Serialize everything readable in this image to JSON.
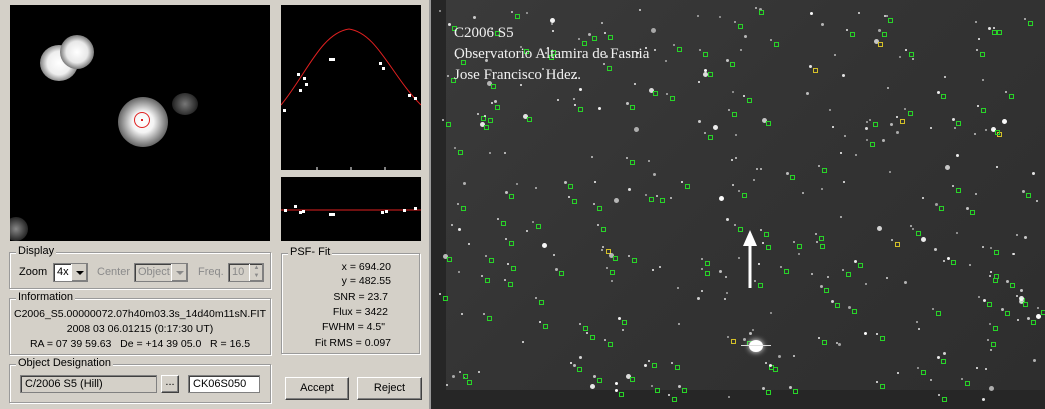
{
  "display": {
    "legend": "Display",
    "zoom_label": "Zoom",
    "zoom_value": "4x",
    "center_label": "Center",
    "center_value": "Object",
    "freq_label": "Freq.",
    "freq_value": "10"
  },
  "information": {
    "legend": "Information",
    "filename": "C2006_S5.00000072.07h40m03.3s_14d40m11sN.FIT",
    "datetime": "2008 03 06.01215 (0:17:30 UT)",
    "coords": "RA = 07 39 59.63   De = +14 39 05.0   R = 16.5"
  },
  "psf_fit": {
    "legend": "PSF- Fit",
    "x": "x = 694.20",
    "y": "y = 482.55",
    "snr": "SNR = 23.7",
    "flux": "Flux = 3422",
    "fwhm": "FWHM = 4.5\"",
    "fit_rms": "Fit RMS = 0.097"
  },
  "object_designation": {
    "legend": "Object Designation",
    "name": "C/2006 S5 (Hill)",
    "code": "CK06S050"
  },
  "buttons": {
    "browse": "...",
    "accept": "Accept",
    "reject": "Reject"
  },
  "image_caption": {
    "line1": "C2006 S5",
    "line2": "Observatorio Altamira de Fasnia",
    "line3": "Jose Francisco Hdez."
  }
}
